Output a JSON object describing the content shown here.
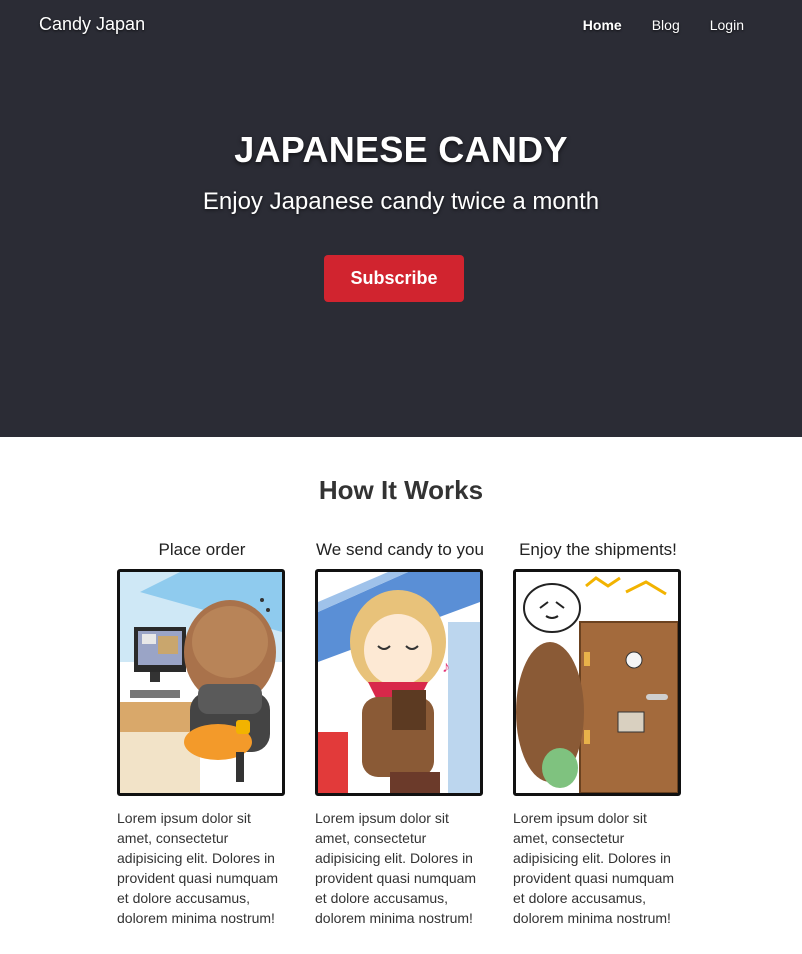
{
  "nav": {
    "brand": "Candy Japan",
    "links": [
      "Home",
      "Blog",
      "Login"
    ]
  },
  "hero": {
    "title": "JAPANESE CANDY",
    "subtitle": "Enjoy Japanese candy twice a month",
    "cta": "Subscribe"
  },
  "how": {
    "title": "How It Works",
    "steps": [
      {
        "title": "Place order",
        "text": "Lorem ipsum dolor sit amet, consectetur adipisicing elit. Dolores in provident quasi numquam et dolore accusamus, dolorem minima nostrum!"
      },
      {
        "title": "We send candy to you",
        "text": "Lorem ipsum dolor sit amet, consectetur adipisicing elit. Dolores in provident quasi numquam et dolore accusamus, dolorem minima nostrum!"
      },
      {
        "title": "Enjoy the shipments!",
        "text": "Lorem ipsum dolor sit amet, consectetur adipisicing elit. Dolores in provident quasi numquam et dolore accusamus, dolorem minima nostrum!"
      }
    ]
  },
  "colors": {
    "hero_bg": "#2b2c35",
    "cta_bg": "#d1242f"
  }
}
